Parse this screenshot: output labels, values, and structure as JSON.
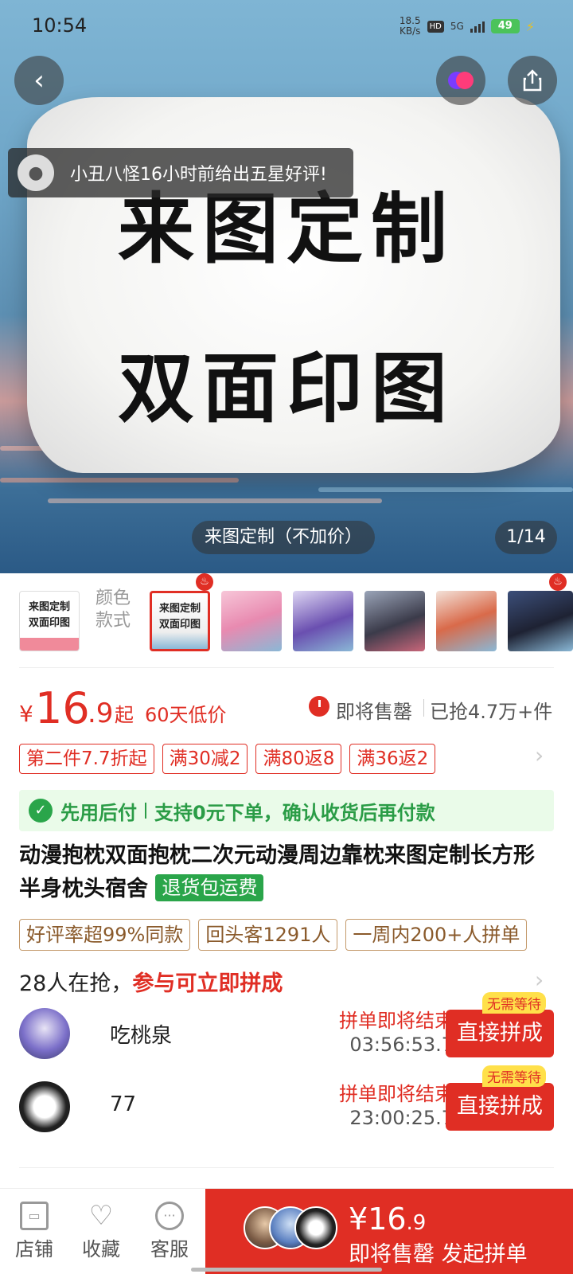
{
  "status_bar": {
    "time": "10:54",
    "net_speed_value": "18.5",
    "net_speed_unit": "KB/s",
    "hd": "HD",
    "network": "5G",
    "battery": "49"
  },
  "hero": {
    "pillow_line1": "来图定制",
    "pillow_line2": "双面印图",
    "review_toast": "小丑八怪16小时前给出五星好评!",
    "variant_caption": "来图定制（不加价）",
    "page_indicator": "1/14"
  },
  "thumbs": {
    "first_line1": "来图定制",
    "first_line2": "双面印图",
    "label_line1": "颜色",
    "label_line2": "款式",
    "selected_line1": "来图定制",
    "selected_line2": "双面印图"
  },
  "price": {
    "symbol": "¥",
    "integer": "16",
    "decimal": ".9",
    "suffix": "起",
    "low_price_note": "60天低价",
    "sell_out": "即将售罄",
    "sold": "已抢4.7万+件"
  },
  "promos": [
    "第二件7.7折起",
    "满30减2",
    "满80返8",
    "满36返2"
  ],
  "pay_later": {
    "title": "先用后付",
    "detail": "支持0元下单，确认收货后再付款"
  },
  "product": {
    "title": "动漫抱枕双面抱枕二次元动漫周边靠枕来图定制长方形半身枕头宿舍",
    "refund_tag": "退货包运费"
  },
  "honors": [
    "好评率超99%同款",
    "回头客1291人",
    "一周内200+人拼单"
  ],
  "grab": {
    "count": "28人在抢，",
    "hint": "参与可立即拼成"
  },
  "groups": [
    {
      "name": "吃桃泉",
      "ending": "拼单即将结束",
      "timer": "03:56:53.7",
      "button": "直接拼成",
      "badge": "无需等待"
    },
    {
      "name": "77",
      "ending": "拼单即将结束",
      "timer": "23:00:25.7",
      "button": "直接拼成",
      "badge": "无需等待"
    }
  ],
  "bottom_bar": {
    "store": "店铺",
    "favorite": "收藏",
    "service": "客服",
    "cta_price_symbol": "¥",
    "cta_price_integer": "16",
    "cta_price_decimal": ".9",
    "cta_label": "即将售罄 发起拼单"
  },
  "colors": {
    "accent": "#e02e24",
    "green": "#2aa54a"
  }
}
